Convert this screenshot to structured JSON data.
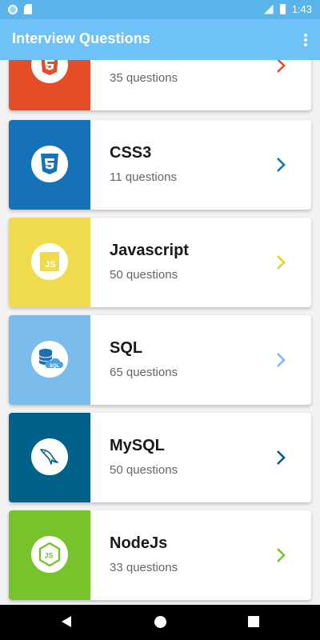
{
  "status_bar": {
    "time": "1:43"
  },
  "app_bar": {
    "title": "Interview Questions",
    "menu_icon": "more-vert-icon"
  },
  "colors": {
    "status_bar": "#5ab4ea",
    "app_bar": "#6ec2f7",
    "html5": "#e44d26",
    "css3": "#1572b6",
    "javascript": "#f0db4f",
    "sql": "#7bbcec",
    "mysql": "#00618a",
    "nodejs": "#76c32c"
  },
  "topics": [
    {
      "name": "",
      "count_text": "35 questions",
      "icon": "html5-icon",
      "color": "#e44d26"
    },
    {
      "name": "CSS3",
      "count_text": "11 questions",
      "icon": "css3-icon",
      "color": "#1572b6"
    },
    {
      "name": "Javascript",
      "count_text": "50 questions",
      "icon": "javascript-icon",
      "color": "#f0db4f"
    },
    {
      "name": "SQL",
      "count_text": "65 questions",
      "icon": "sql-database-icon",
      "color": "#7bbcec"
    },
    {
      "name": "MySQL",
      "count_text": "50 questions",
      "icon": "mysql-dolphin-icon",
      "color": "#00618a"
    },
    {
      "name": "NodeJs",
      "count_text": "33 questions",
      "icon": "nodejs-icon",
      "color": "#76c32c"
    }
  ],
  "nav_bar": {
    "buttons": [
      "back-icon",
      "home-icon",
      "recents-icon"
    ]
  }
}
